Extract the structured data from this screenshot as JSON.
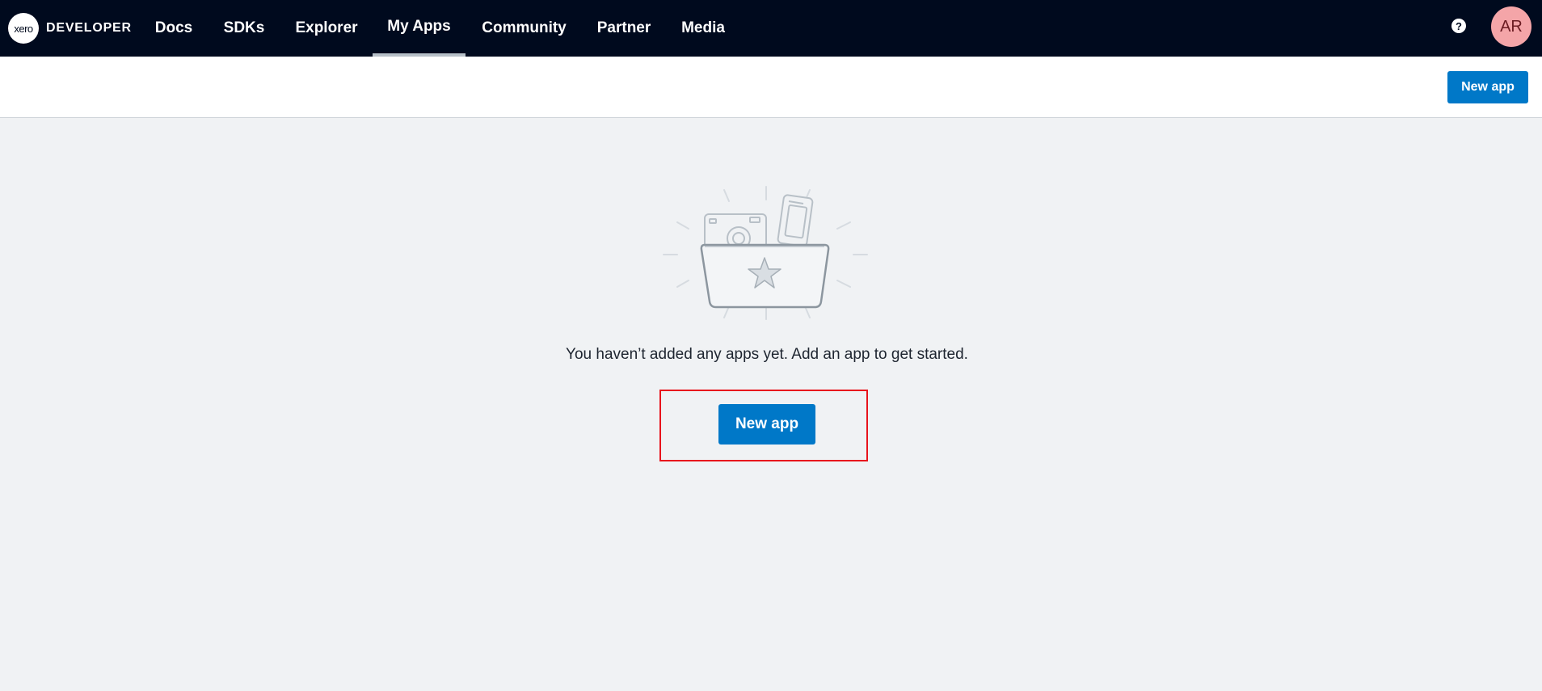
{
  "nav": {
    "logo_text": "xero",
    "brand": "DEVELOPER",
    "items": [
      {
        "label": "Docs"
      },
      {
        "label": "SDKs"
      },
      {
        "label": "Explorer"
      },
      {
        "label": "My Apps",
        "active": true
      },
      {
        "label": "Community"
      },
      {
        "label": "Partner"
      },
      {
        "label": "Media"
      }
    ],
    "help_glyph": "?",
    "avatar_initials": "AR"
  },
  "subheader": {
    "new_app_label": "New app"
  },
  "empty_state": {
    "message": "You haven’t added any apps yet. Add an app to get started.",
    "new_app_label": "New app",
    "illustration_icon": "folder-with-camera-and-phone-icon"
  },
  "colors": {
    "nav_background": "#000a1e",
    "primary_button": "#0078c8",
    "page_background": "#f0f2f4",
    "highlight": "#e8141c",
    "avatar": "#f4a5a8"
  }
}
